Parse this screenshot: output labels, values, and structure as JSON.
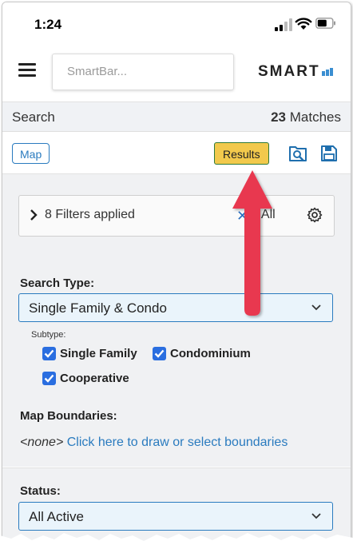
{
  "status_bar": {
    "time": "1:24"
  },
  "header": {
    "search_placeholder": "SmartBar...",
    "logo_text": "SMART"
  },
  "search_row": {
    "label": "Search",
    "match_count": "23",
    "match_label": "Matches"
  },
  "toolbar": {
    "map_label": "Map",
    "results_label": "Results"
  },
  "filters": {
    "summary": "8 Filters applied",
    "clear_label": "r All"
  },
  "search_type": {
    "label": "Search Type:",
    "selected": "Single Family & Condo",
    "subtype_label": "Subtype:",
    "subtypes": [
      {
        "label": "Single Family",
        "checked": true
      },
      {
        "label": "Condominium",
        "checked": true
      },
      {
        "label": "Cooperative",
        "checked": true
      }
    ]
  },
  "map_boundaries": {
    "label": "Map Boundaries:",
    "none_text": "<none>",
    "link_text": "Click here to draw or select boundaries"
  },
  "status": {
    "label": "Status:",
    "selected": "All Active"
  },
  "colors": {
    "accent": "#2a7bbf",
    "results_button": "#f2c94c",
    "checkbox": "#2a6ee0",
    "annotation_arrow": "#e8384f"
  },
  "icons": [
    "hamburger-icon",
    "signal-icon",
    "wifi-icon",
    "battery-icon",
    "search-results-icon",
    "save-icon",
    "chevron-right-icon",
    "clear-x-icon",
    "gear-icon",
    "chevron-down-icon",
    "checkmark-icon",
    "annotation-arrow"
  ]
}
